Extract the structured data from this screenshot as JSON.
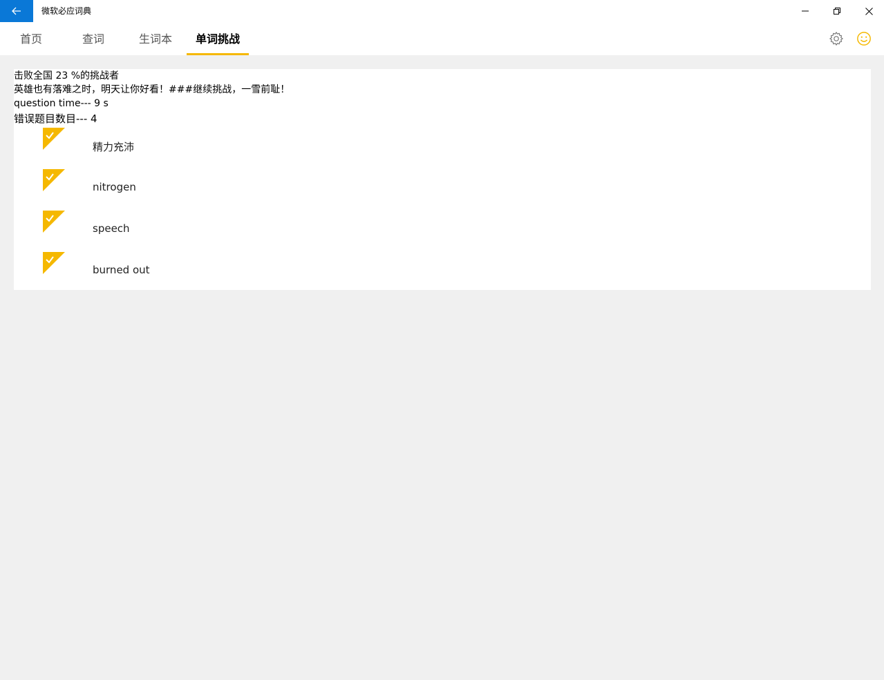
{
  "window": {
    "title": "微软必应词典"
  },
  "nav": {
    "tabs": [
      {
        "label": "首页"
      },
      {
        "label": "查词"
      },
      {
        "label": "生词本"
      },
      {
        "label": "单词挑战"
      }
    ],
    "active_tab": "单词挑战",
    "accent_color": "#f5b800"
  },
  "result": {
    "rank_text": "击败全国 23 %的挑战者",
    "message": "英雄也有落难之时，明天让你好看！###继续挑战，一雪前耻！",
    "time_text": "question time--- 9 s",
    "wrong_count_text": "错误题目数目--- 4"
  },
  "words": [
    {
      "text": "精力充沛"
    },
    {
      "text": "nitrogen"
    },
    {
      "text": "speech"
    },
    {
      "text": "burned out"
    }
  ],
  "icons": {
    "back": "arrow-left-icon",
    "settings": "gear-icon",
    "feedback": "smiley-icon",
    "check": "check-corner-icon"
  }
}
